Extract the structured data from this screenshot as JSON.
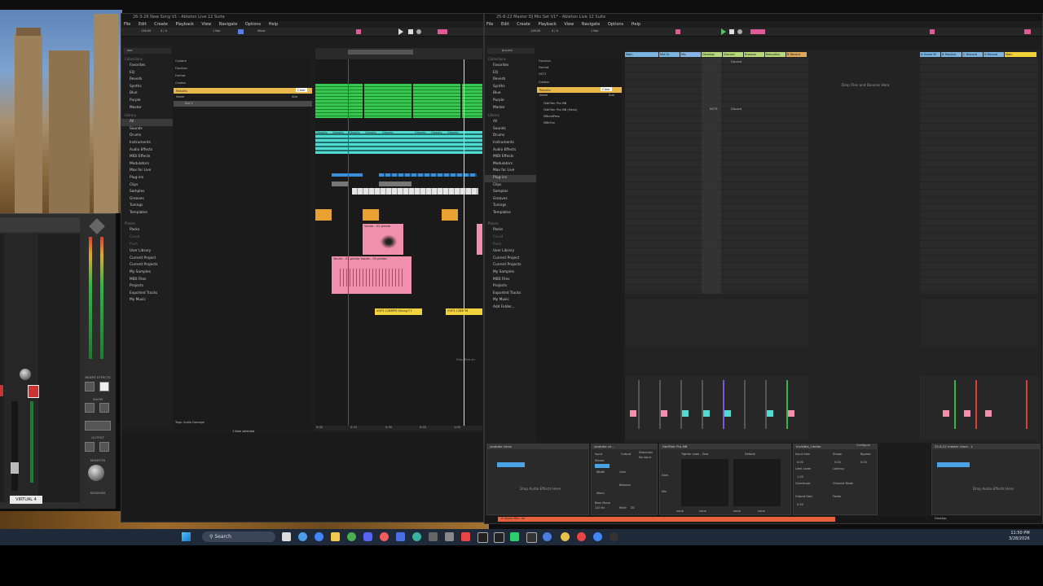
{
  "left_window": {
    "title": "26-3-26 New Song V1 - Ableton Live 12 Suite",
    "menu": [
      "File",
      "Edit",
      "Create",
      "Playback",
      "View",
      "Navigate",
      "Options",
      "Help"
    ],
    "tempo": "138.00",
    "meter": "4 / 4",
    "bar_setting": "1 Bar",
    "key": "Minor",
    "search_value": "eve",
    "collections_header": "Collections",
    "collections": [
      "Favorites",
      "EQ",
      "Reverb",
      "Synths",
      "Blue",
      "Purple",
      "Master"
    ],
    "library_header": "Library",
    "library": [
      "All",
      "Sounds",
      "Drums",
      "Instruments",
      "Audio Effects",
      "MIDI Effects",
      "Modulators",
      "Max for Live",
      "Plug-ins",
      "Clips",
      "Samples",
      "Grooves",
      "Tunings",
      "Templates"
    ],
    "places_header": "Places",
    "places": [
      "Packs",
      "Cloud",
      "Push",
      "User Library",
      "Current Project",
      "Current Projects",
      "My Samples",
      "MIDI Files",
      "Projects",
      "Exported Tracks",
      "My Music"
    ],
    "filters": [
      "Content",
      "Function",
      "Format",
      "Creator"
    ],
    "results_label": "Results",
    "clear_label": "Clear",
    "name_col": "Name",
    "size_col": "Size",
    "result_item": "Eve 2",
    "clips_ghost": "Ghostly",
    "clip_vocals": "Vocals - 02-pinato",
    "clip_vocals2": "Vocals - 03-pinato Vocals - 02-pinato",
    "clip_vuf1": "VUF3 128BPM Strong F1",
    "clip_vuf2": "VUF3 128BPM",
    "drop_files": "Drop Files an",
    "tags_label": "Tags:",
    "tags_value": "Audio Damage",
    "status": "1 Item selected",
    "time_ruler": [
      "0:00",
      "0:15",
      "0:30",
      "0:45",
      "1:00"
    ]
  },
  "right_window": {
    "title": "25-8-22 Master DJ Mix Set V1* - Ableton Live 12 Suite",
    "menu": [
      "File",
      "Edit",
      "Create",
      "Playback",
      "View",
      "Navigate",
      "Options",
      "Help"
    ],
    "tempo": "128.00",
    "meter": "4 / 4",
    "bar_setting": "1 Bar",
    "search_value": "pro-mb",
    "filters": [
      "Function",
      "Format",
      "VST3",
      "Creator"
    ],
    "results_label": "Results",
    "clear_label": "Clear",
    "name_col": "Name",
    "size_col": "Size",
    "results": [
      "FabFilter Pro-MB",
      "FabFilter Pro-MB (Mono)",
      "MBandPass",
      "MBitFun"
    ],
    "collections_header": "Collections",
    "collections": [
      "Favorites",
      "EQ",
      "Reverb",
      "Synths",
      "Blue",
      "Purple",
      "Master"
    ],
    "library_header": "Library",
    "library": [
      "All",
      "Sounds",
      "Drums",
      "Instruments",
      "Audio Effects",
      "MIDI Effects",
      "Modulators",
      "Max for Live",
      "Plug-ins",
      "Clips",
      "Samples",
      "Grooves",
      "Tunings",
      "Templates"
    ],
    "places_header": "Places",
    "places": [
      "Packs",
      "Cloud",
      "Push",
      "User Library",
      "Current Project",
      "Current Projects",
      "My Samples",
      "MIDI Files",
      "Projects",
      "Exported Tracks",
      "My Music",
      "Add Folder..."
    ],
    "tracks": [
      "Main",
      "Mid Gr",
      "Mic",
      "Desktop",
      "Discord",
      "Browser",
      "Rekordbo",
      "B Record"
    ],
    "tracks_right": [
      "A Game M",
      "B Monitor",
      "C Discord",
      "D Record",
      "Main"
    ],
    "drop_files_devices": "Drop Files and Devices Here",
    "clip_discord": "Discord",
    "clip_note": "NOTE",
    "status_track": "A Game Mix - to",
    "view_label": "Desktop"
  },
  "devices": {
    "track_left": "youtube chain",
    "track_mid": "youtube ch...",
    "fabfilter": "FabFilter Pro-MB",
    "tighter": "Tighter Lows - Zeal",
    "invisible": "Invisible_Limiter",
    "configure": "Configure",
    "master_chain": "25-8-22 master chain - L",
    "drop_effects": "Drop Audio Effects Here",
    "chain": "Chain",
    "input": "Input",
    "output": "Output",
    "sidechain": "Sidechain",
    "no_input": "No Input",
    "stereo": "Stereo",
    "width": "Width",
    "mono": "Mono",
    "bass_mono": "Bass Mono",
    "hz": "120 Hz",
    "mute": "Mute",
    "dc": "DC",
    "gain": "Gain",
    "balance": "Balance",
    "mix": "Mix",
    "input_gain": "Input Gain",
    "limit_level": "Limit Level",
    "latency": "Latency",
    "shape": "Shape",
    "bypass": "Bypass",
    "oversampling": "Overshoot",
    "channel_mode": "Channel Mode",
    "output_gain": "Output Gain",
    "factor": "Factor",
    "default": "Default",
    "none": "none",
    "values": [
      "0.00",
      "1.00",
      "0.00",
      "0.00",
      "0.00",
      "0.50"
    ]
  },
  "uad": {
    "label": "VIRTUAL 4",
    "insert_effects": "INSERT EFFECTS",
    "show": "SHOW",
    "output": "OUTPUT",
    "monitor": "MONITOR",
    "sessions": "SESSIONS"
  },
  "taskbar": {
    "search": "Search",
    "time": "11:50 PM",
    "date": "3/28/2026"
  }
}
